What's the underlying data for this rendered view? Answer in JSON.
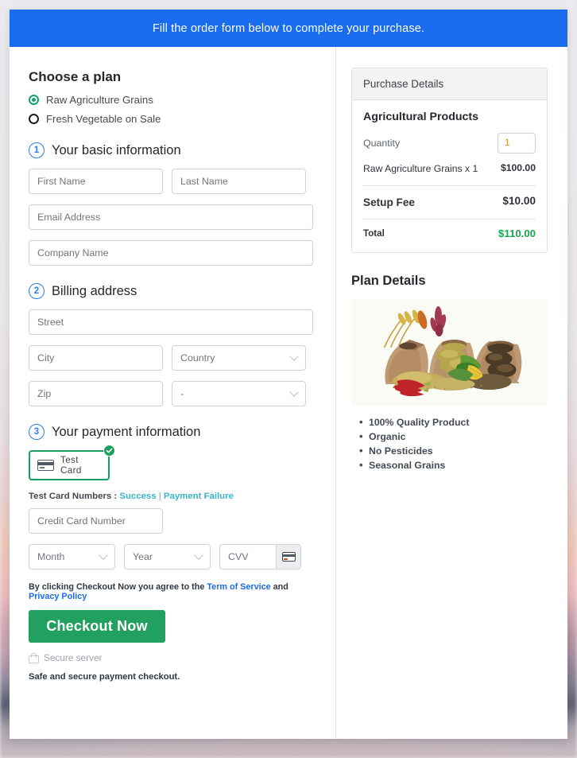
{
  "topbar": {
    "message": "Fill the order form below to complete your purchase."
  },
  "plan_chooser": {
    "heading": "Choose a plan",
    "options": [
      {
        "label": "Raw Agriculture Grains",
        "selected": true
      },
      {
        "label": "Fresh Vegetable on Sale",
        "selected": false
      }
    ]
  },
  "steps": {
    "basic": {
      "number": "1",
      "title": "Your basic information"
    },
    "billing": {
      "number": "2",
      "title": "Billing address"
    },
    "payment": {
      "number": "3",
      "title": "Your payment information"
    }
  },
  "basic_fields": {
    "first_name": {
      "placeholder": "First Name",
      "value": ""
    },
    "last_name": {
      "placeholder": "Last Name",
      "value": ""
    },
    "email": {
      "placeholder": "Email Address",
      "value": ""
    },
    "company": {
      "placeholder": "Company Name",
      "value": ""
    }
  },
  "billing_fields": {
    "street": {
      "placeholder": "Street",
      "value": ""
    },
    "city": {
      "placeholder": "City",
      "value": ""
    },
    "country": {
      "selected": "Country"
    },
    "zip": {
      "placeholder": "Zip",
      "value": ""
    },
    "state": {
      "selected": "-"
    }
  },
  "payment": {
    "card_option_label": "Test  Card",
    "card_option_selected": true,
    "test_numbers_label": "Test Card Numbers :",
    "test_success_link": "Success",
    "test_separator": "|",
    "test_failure_link": "Payment Failure",
    "card_number": {
      "placeholder": "Credit Card Number",
      "value": ""
    },
    "month": {
      "selected": "Month"
    },
    "year": {
      "selected": "Year"
    },
    "cvv": {
      "placeholder": "CVV",
      "value": ""
    }
  },
  "footer": {
    "terms_prefix": "By clicking Checkout Now you agree to the",
    "terms_link": "Term of Service",
    "terms_and": "and",
    "privacy_link": "Privacy Policy",
    "checkout_button": "Checkout Now",
    "secure_server": "Secure server",
    "safe_note": "Safe and secure payment checkout."
  },
  "purchase": {
    "panel_title": "Purchase Details",
    "product_title": "Agricultural Products",
    "quantity_label": "Quantity",
    "quantity_value": "1",
    "line_item_label": "Raw Agriculture Grains x 1",
    "line_item_amount": "$100.00",
    "setup_fee_label": "Setup Fee",
    "setup_fee_amount": "$10.00",
    "total_label": "Total",
    "total_amount": "$110.00"
  },
  "plan_details": {
    "title": "Plan Details",
    "image_alt": "grain-sacks-photo",
    "benefits": [
      "100% Quality Product",
      "Organic",
      "No Pesticides",
      "Seasonal Grains"
    ]
  },
  "colors": {
    "topbar_blue": "#1a6cef",
    "accent_green": "#22a05f",
    "total_green": "#19a84e",
    "link_teal": "#39b6c8",
    "link_blue": "#1a6cef",
    "step_blue": "#2b7cf0"
  }
}
